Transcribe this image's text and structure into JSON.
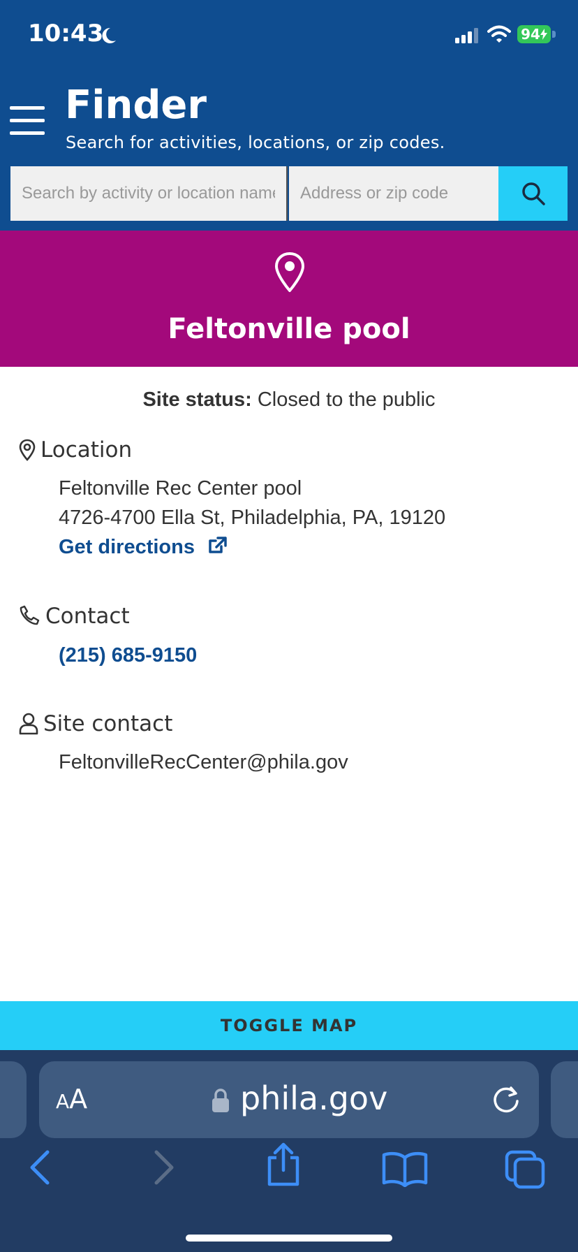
{
  "status_bar": {
    "time": "10:43",
    "battery": "94"
  },
  "header": {
    "title": "Finder",
    "subtitle": "Search for activities, locations, or zip codes.",
    "search_activity_placeholder": "Search by activity or location name",
    "search_address_placeholder": "Address or zip code"
  },
  "banner": {
    "site_name": "Feltonville pool"
  },
  "site_status": {
    "label": "Site status:",
    "value": "Closed to the public"
  },
  "location": {
    "heading": "Location",
    "name": "Feltonville Rec Center pool",
    "address": "4726-4700 Ella St, Philadelphia, PA, 19120",
    "directions_label": "Get directions"
  },
  "contact": {
    "heading": "Contact",
    "phone": "(215) 685-9150"
  },
  "site_contact": {
    "heading": "Site contact",
    "email": "FeltonvilleRecCenter@phila.gov"
  },
  "toggle_map_label": "TOGGLE MAP",
  "browser": {
    "aa_large": "A",
    "aa_small": "A",
    "url": "phila.gov"
  },
  "colors": {
    "header_blue": "#0f4d90",
    "banner_magenta": "#a3097b",
    "accent_cyan": "#25cef7",
    "browser_bg": "#223c63"
  }
}
